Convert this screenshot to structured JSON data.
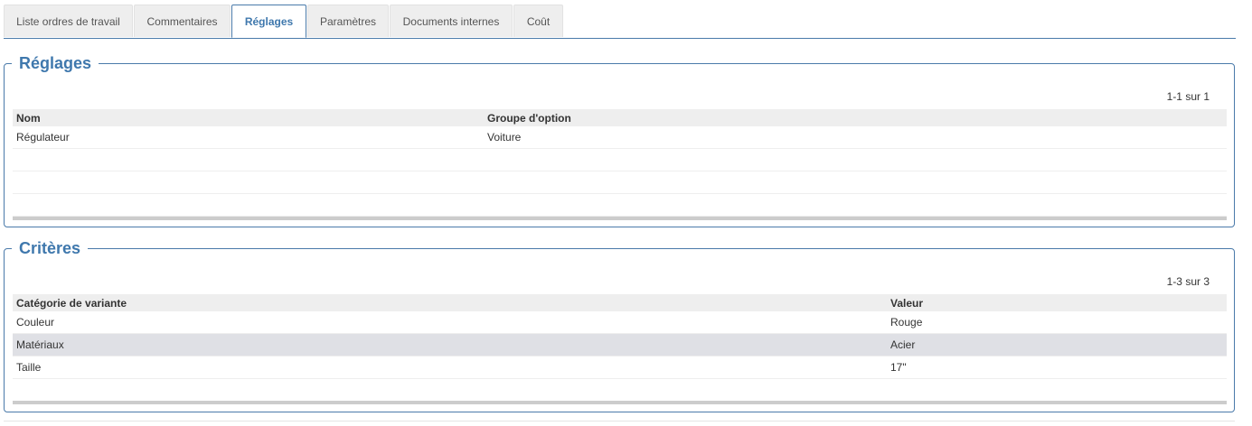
{
  "tabs": [
    {
      "label": "Liste ordres de travail",
      "active": false
    },
    {
      "label": "Commentaires",
      "active": false
    },
    {
      "label": "Réglages",
      "active": true
    },
    {
      "label": "Paramètres",
      "active": false
    },
    {
      "label": "Documents internes",
      "active": false
    },
    {
      "label": "Coût",
      "active": false
    }
  ],
  "reglages": {
    "title": "Réglages",
    "pager": "1-1 sur 1",
    "columns": [
      "Nom",
      "Groupe d'option"
    ],
    "rows": [
      [
        "Régulateur",
        "Voiture"
      ]
    ]
  },
  "criteres": {
    "title": "Critères",
    "pager": "1-3 sur 3",
    "columns": [
      "Catégorie de variante",
      "Valeur"
    ],
    "rows": [
      [
        "Couleur",
        "Rouge"
      ],
      [
        "Matériaux",
        "Acier"
      ],
      [
        "Taille",
        "17\""
      ]
    ]
  },
  "colors": {
    "accent": "#3f78ad",
    "border": "#4a7aaa",
    "header_bg": "#eeeeee",
    "row_highlight": "#dfe0e5"
  }
}
